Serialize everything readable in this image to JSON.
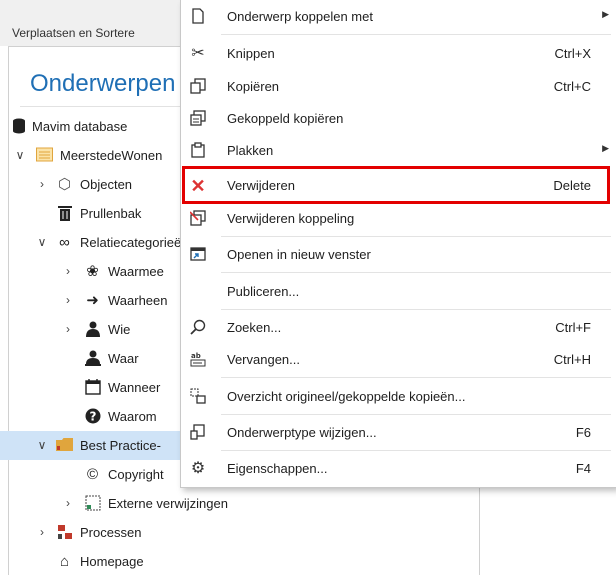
{
  "panel_caption": "Verplaatsen en Sortere",
  "tree_title": "Onderwerpen",
  "tree": [
    {
      "label": "Mavim database",
      "icon": "database-icon",
      "chevron": ""
    },
    {
      "label": "MeerstedeWonen",
      "icon": "folder-icon",
      "chevron": "expanded"
    },
    {
      "label": "Objecten",
      "icon": "cube-icon",
      "chevron": "collapsed"
    },
    {
      "label": "Prullenbak",
      "icon": "trash-icon",
      "chevron": ""
    },
    {
      "label": "Relatiecategorieën",
      "icon": "link-icon",
      "chevron": "expanded"
    },
    {
      "label": "Waarmee",
      "icon": "group-icon",
      "chevron": "collapsed"
    },
    {
      "label": "Waarheen",
      "icon": "arrow-right-icon",
      "chevron": "collapsed"
    },
    {
      "label": "Wie",
      "icon": "person-icon",
      "chevron": "collapsed"
    },
    {
      "label": "Waar",
      "icon": "person-location-icon",
      "chevron": ""
    },
    {
      "label": "Wanneer",
      "icon": "calendar-icon",
      "chevron": ""
    },
    {
      "label": "Waarom",
      "icon": "question-icon",
      "chevron": ""
    },
    {
      "label": "Best Practice-",
      "icon": "folder-icon",
      "chevron": "expanded",
      "selected": true
    },
    {
      "label": "Copyright",
      "icon": "copyright-icon",
      "chevron": ""
    },
    {
      "label": "Externe verwijzingen",
      "icon": "external-doc-icon",
      "chevron": "collapsed"
    },
    {
      "label": "Processen",
      "icon": "process-icon",
      "chevron": "collapsed"
    },
    {
      "label": "Homepage",
      "icon": "home-icon",
      "chevron": ""
    }
  ],
  "menu": [
    {
      "label": "Onderwerp koppelen met",
      "icon": "link-doc-icon",
      "shortcut": "",
      "submenu": true
    },
    {
      "label": "Knippen",
      "icon": "scissors-icon",
      "shortcut": "Ctrl+X",
      "submenu": false
    },
    {
      "label": "Kopiëren",
      "icon": "copy-icon",
      "shortcut": "Ctrl+C",
      "submenu": false
    },
    {
      "label": "Gekoppeld kopiëren",
      "icon": "linked-copy-icon",
      "shortcut": "",
      "submenu": false
    },
    {
      "label": "Plakken",
      "icon": "paste-icon",
      "shortcut": "",
      "submenu": true
    },
    {
      "label": "Verwijderen",
      "icon": "delete-x-icon",
      "shortcut": "Delete",
      "submenu": false,
      "highlighted": true
    },
    {
      "label": "Verwijderen koppeling",
      "icon": "unlink-icon",
      "shortcut": "",
      "submenu": false
    },
    {
      "label": "Openen in nieuw venster",
      "icon": "new-window-icon",
      "shortcut": "",
      "submenu": false
    },
    {
      "label": "Publiceren...",
      "icon": "",
      "shortcut": "",
      "submenu": false
    },
    {
      "label": "Zoeken...",
      "icon": "search-icon",
      "shortcut": "Ctrl+F",
      "submenu": false
    },
    {
      "label": "Vervangen...",
      "icon": "replace-icon",
      "shortcut": "Ctrl+H",
      "submenu": false
    },
    {
      "label": "Overzicht origineel/gekoppelde kopieën...",
      "icon": "overview-icon",
      "shortcut": "",
      "submenu": false
    },
    {
      "label": "Onderwerptype wijzigen...",
      "icon": "change-type-icon",
      "shortcut": "F6",
      "submenu": false
    },
    {
      "label": "Eigenschappen...",
      "icon": "gear-icon",
      "shortcut": "F4",
      "submenu": false
    }
  ],
  "highlight_color": "#e30000",
  "selection_color": "#cfe3f7",
  "title_color": "#1f6fb5"
}
